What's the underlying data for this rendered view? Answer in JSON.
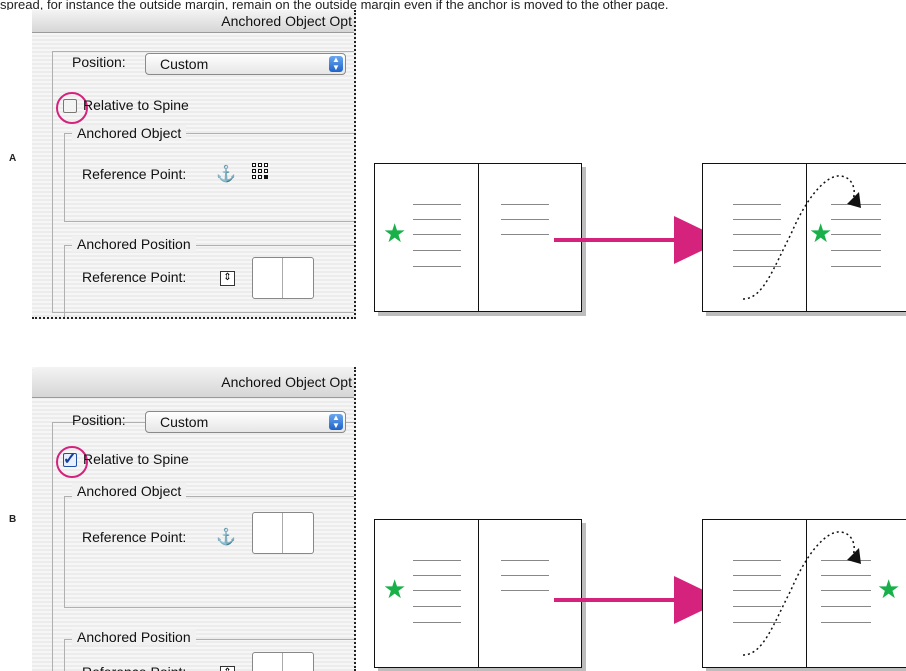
{
  "top_text": "spread, for instance the outside margin, remain on the outside margin even if the anchor is moved to the other page.",
  "sections": {
    "a_letter": "A",
    "b_letter": "B"
  },
  "dialog": {
    "title": "Anchored Object Opt",
    "position_label": "Position:",
    "position_value": "Custom",
    "relative_to_spine_label": "Relative to Spine",
    "anchored_object_group": "Anchored Object",
    "anchored_position_group": "Anchored Position",
    "reference_point_label": "Reference Point:"
  },
  "states": {
    "a_checked": false,
    "b_checked": true
  },
  "colors": {
    "arrow": "#d5227d",
    "star": "#19b04a",
    "ring": "#d5227d"
  },
  "icons": [
    "anchor-icon",
    "reference-point-grid-icon",
    "spread-reference-icon",
    "page-reference-icon",
    "star-icon",
    "arrow-icon"
  ]
}
